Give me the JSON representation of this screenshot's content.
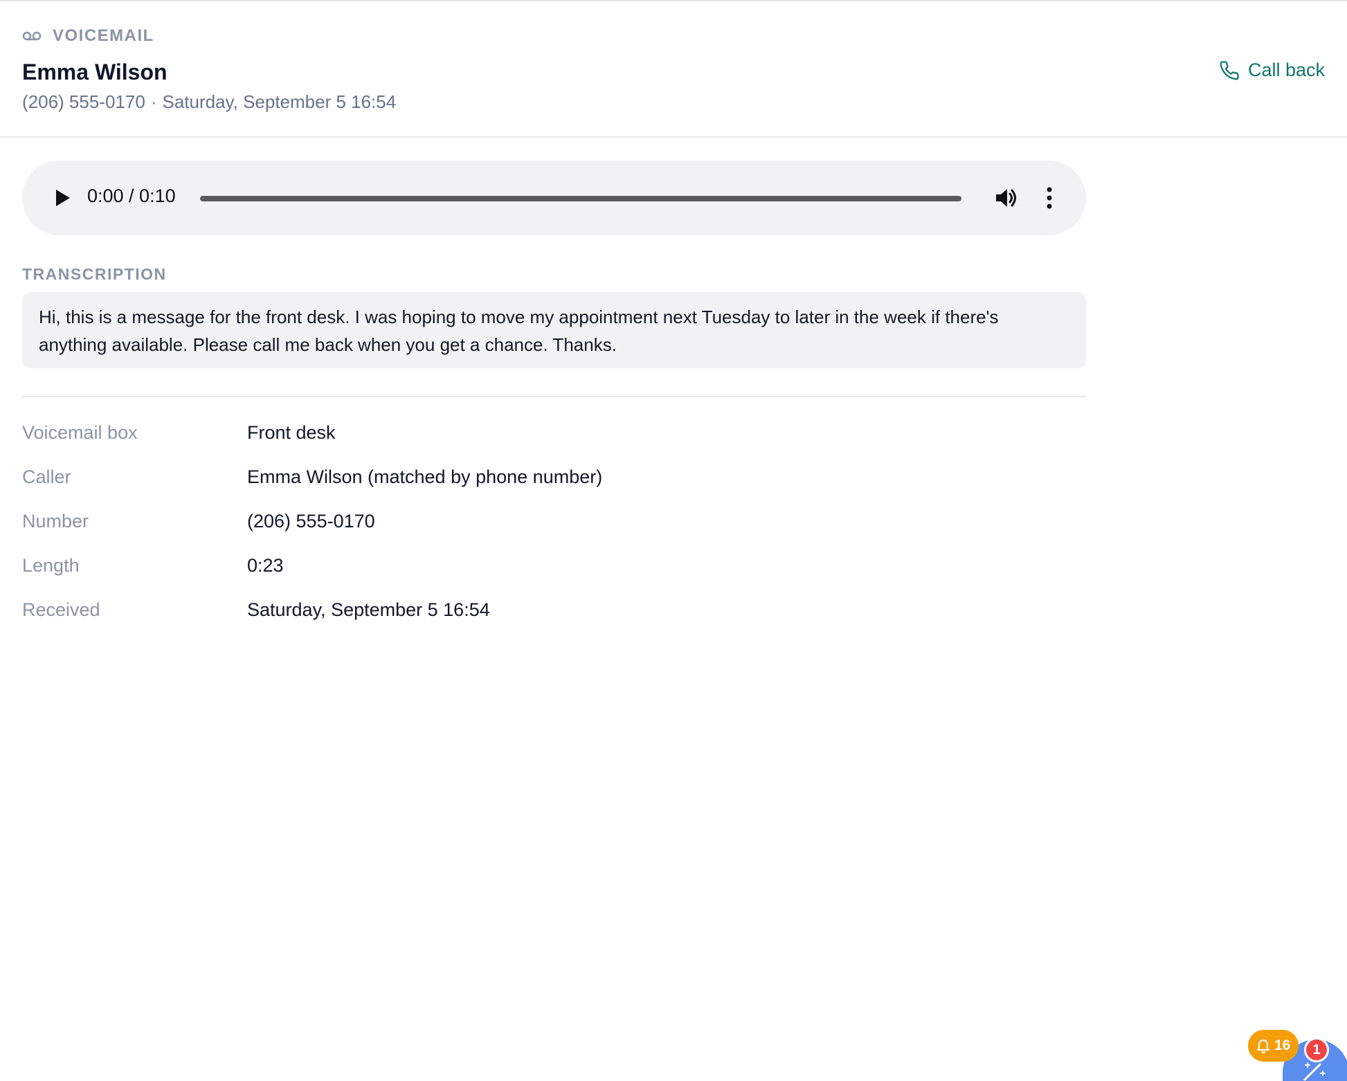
{
  "header": {
    "section_label": "VOICEMAIL",
    "contact_name": "Emma Wilson",
    "phone": "(206) 555-0170",
    "separator": "·",
    "received": "Saturday, September 5 16:54",
    "callback_label": "Call back"
  },
  "player": {
    "time_display": "0:00 / 0:10",
    "progress": 0
  },
  "transcription": {
    "label": "TRANSCRIPTION",
    "text": "Hi, this is a message for the front desk. I was hoping to move my appointment next Tuesday to later in the week if there's anything available. Please call me back when you get a chance. Thanks."
  },
  "details": [
    {
      "label": "Voicemail box",
      "value": "Front desk"
    },
    {
      "label": "Caller",
      "value": "Emma Wilson (matched by phone number)"
    },
    {
      "label": "Number",
      "value": "(206) 555-0170"
    },
    {
      "label": "Length",
      "value": "0:23"
    },
    {
      "label": "Received",
      "value": "Saturday, September 5 16:54"
    }
  ],
  "widgets": {
    "notification_count": "16",
    "alert_count": "1"
  },
  "colors": {
    "accent": "#0f766e",
    "muted": "#8a94a6",
    "notification": "#f59e0b",
    "alert": "#ef4444",
    "fab": "#5b8def"
  },
  "icons": [
    "voicemail-icon",
    "phone-icon",
    "play-icon",
    "volume-icon",
    "more-vertical-icon",
    "bell-icon",
    "magic-wand-icon"
  ]
}
